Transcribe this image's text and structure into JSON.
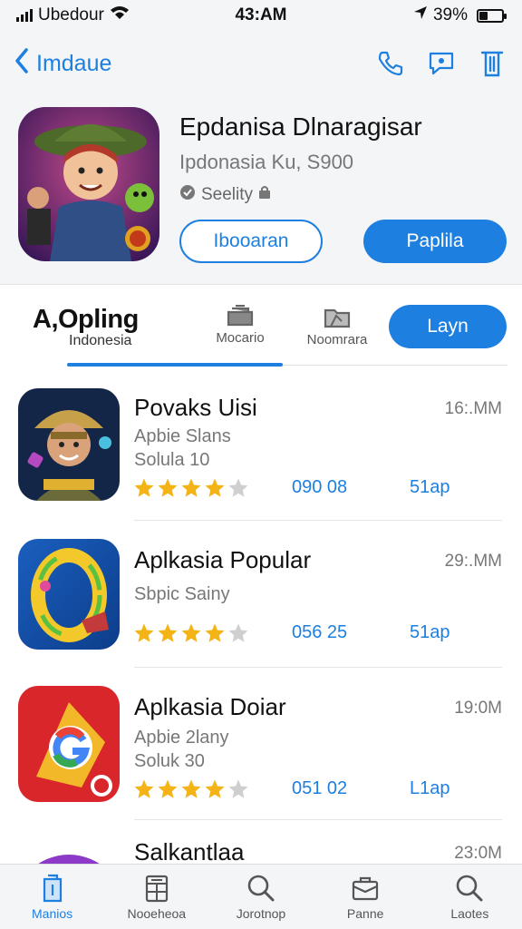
{
  "status_bar": {
    "carrier": "Ubedour",
    "time": "43:AM",
    "battery": "39%",
    "battery_level": 0.39
  },
  "nav": {
    "back_label": "Imdaue"
  },
  "app": {
    "title": "Epdanisa Dlnaragisar",
    "subtitle": "Ipdonasia Ku, S900",
    "meta": "Seelity",
    "secondary_button": "Ibooaran",
    "primary_button": "Paplila"
  },
  "tabs": {
    "main_label": "A,Opling",
    "main_sub": "Indonesia",
    "tab2": "Mocario",
    "tab3": "Noomrara",
    "button": "Layn"
  },
  "colors": {
    "accent": "#1d7fe0",
    "star": "#f4b418",
    "star_empty": "#cfcfcf"
  },
  "list": [
    {
      "name": "Povaks Uisi",
      "size": "16:.MM",
      "sub1": "Apbie Slans",
      "sub2": "Solula 10",
      "rating": 4,
      "count": "090 08",
      "get": "51ap"
    },
    {
      "name": "Aplkasia Popular",
      "size": "29:.MM",
      "sub1": "Sbpic Sainy",
      "sub2": "",
      "rating": 4,
      "count": "056 25",
      "get": "51ap"
    },
    {
      "name": "Aplkasia Doiar",
      "size": "19:0M",
      "sub1": "Apbie 2lany",
      "sub2": "Soluk 30",
      "rating": 4,
      "count": "051 02",
      "get": "L1ap"
    },
    {
      "name": "Salkantlaa",
      "size": "23:0M"
    }
  ],
  "tabbar": [
    {
      "label": "Manios",
      "icon": "apps-icon"
    },
    {
      "label": "Nooeheoa",
      "icon": "calculator-icon"
    },
    {
      "label": "Jorotnop",
      "icon": "search-icon"
    },
    {
      "label": "Panne",
      "icon": "briefcase-icon"
    },
    {
      "label": "Laotes",
      "icon": "search-icon"
    }
  ]
}
